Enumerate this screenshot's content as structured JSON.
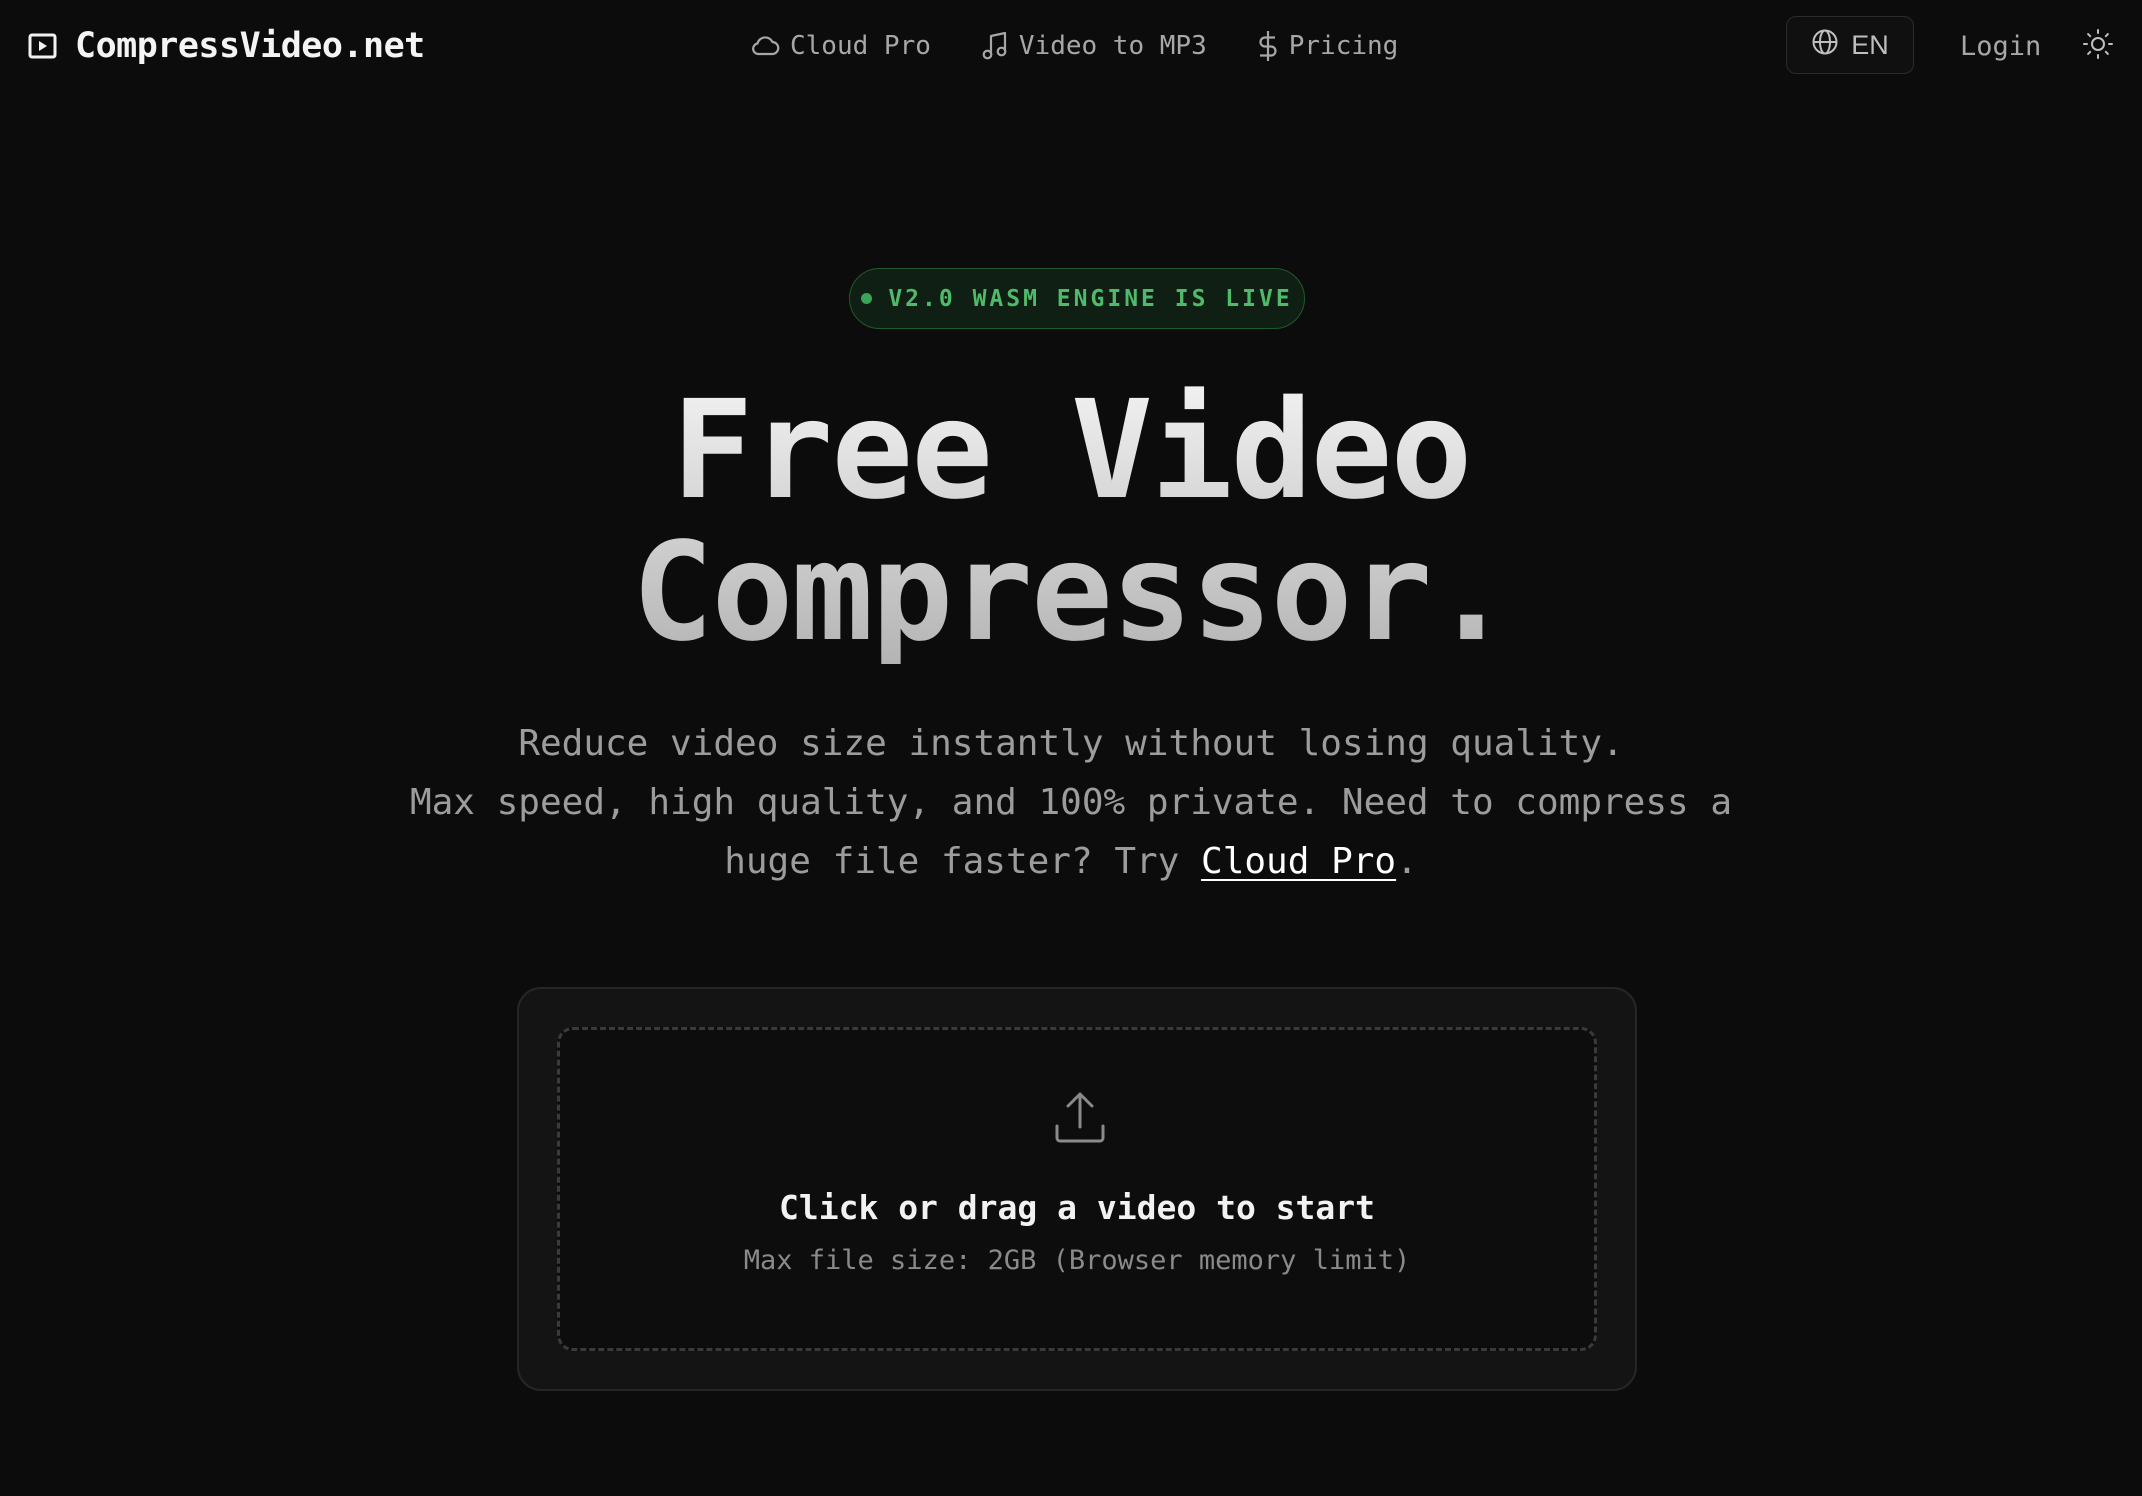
{
  "header": {
    "brand": "CompressVideo.net",
    "nav": [
      {
        "label": "Cloud Pro",
        "icon": "cloud-icon"
      },
      {
        "label": "Video to MP3",
        "icon": "music-note-icon"
      },
      {
        "label": "Pricing",
        "icon": "dollar-icon"
      }
    ],
    "language": "EN",
    "login": "Login"
  },
  "hero": {
    "badge": "V2.0 WASM ENGINE IS LIVE",
    "title_line1": "Free Video",
    "title_line2": "Compressor.",
    "subtitle_line1": "Reduce video size instantly without losing quality.",
    "subtitle_line2": "Max speed, high quality, and 100% private. Need to compress a huge file faster? Try ",
    "subtitle_link": "Cloud Pro",
    "subtitle_end": "."
  },
  "upload": {
    "title": "Click or drag a video to start",
    "hint": "Max file size: 2GB (Browser memory limit)"
  },
  "colors": {
    "background": "#0c0c0c",
    "badge_text": "#4fbb6a",
    "badge_border": "#1f5a2c",
    "muted_text": "#a7a7a7"
  }
}
